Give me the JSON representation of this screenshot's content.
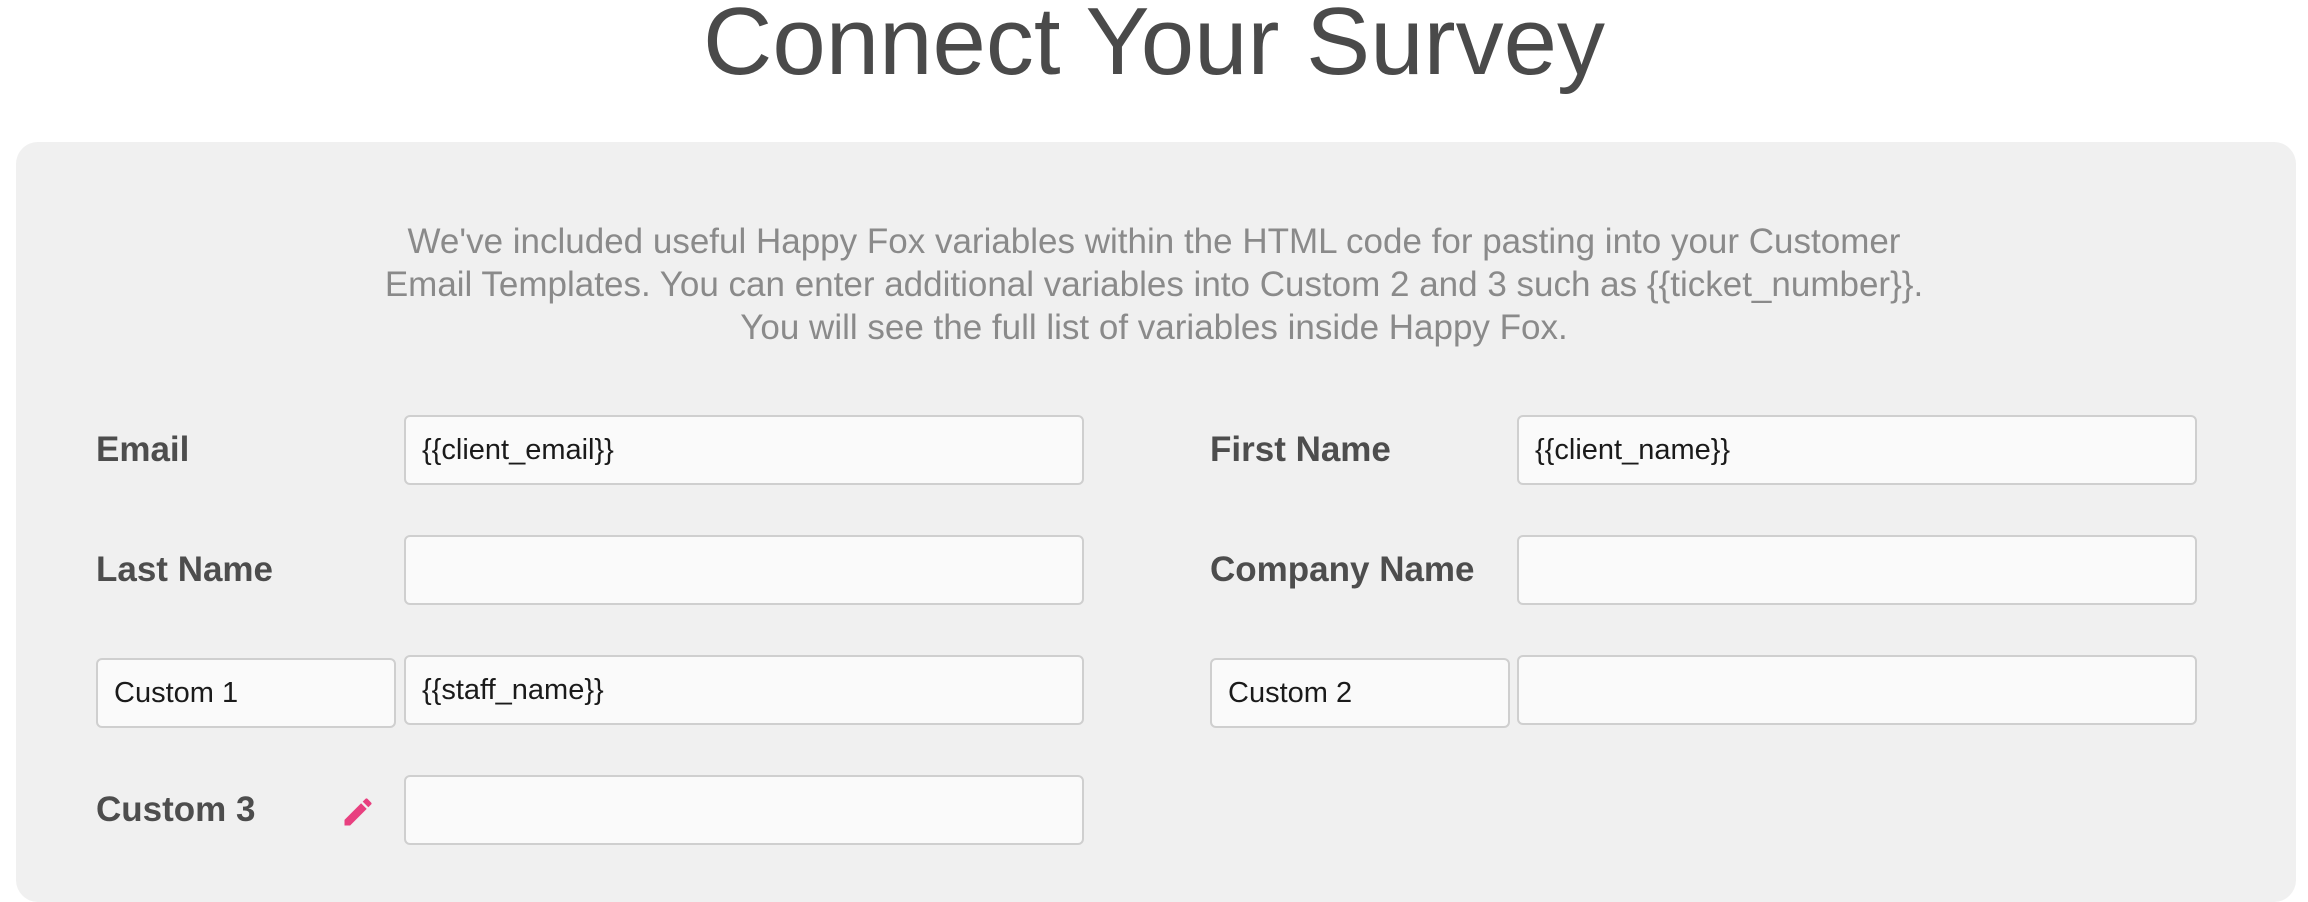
{
  "page": {
    "title": "Connect Your Survey"
  },
  "intro": {
    "lines": [
      "We've included useful Happy Fox variables within the HTML code for pasting into your Customer",
      "Email Templates. You can enter additional variables into Custom 2 and 3 such as {{ticket_number}}.",
      "You will see the full list of variables inside Happy Fox."
    ]
  },
  "form": {
    "email": {
      "label": "Email",
      "value": "{{client_email}}"
    },
    "first_name": {
      "label": "First Name",
      "value": "{{client_name}}"
    },
    "last_name": {
      "label": "Last Name",
      "value": ""
    },
    "company_name": {
      "label": "Company Name",
      "value": ""
    },
    "custom1": {
      "label_value": "Custom 1",
      "value": "{{staff_name}}"
    },
    "custom2": {
      "label_value": "Custom 2",
      "value": ""
    },
    "custom3": {
      "label": "Custom 3",
      "value": "",
      "edit_icon": "pencil-icon"
    }
  },
  "colors": {
    "accent": "#e8407f",
    "title": "#4a4a4a",
    "panel": "#f0f0f0"
  }
}
